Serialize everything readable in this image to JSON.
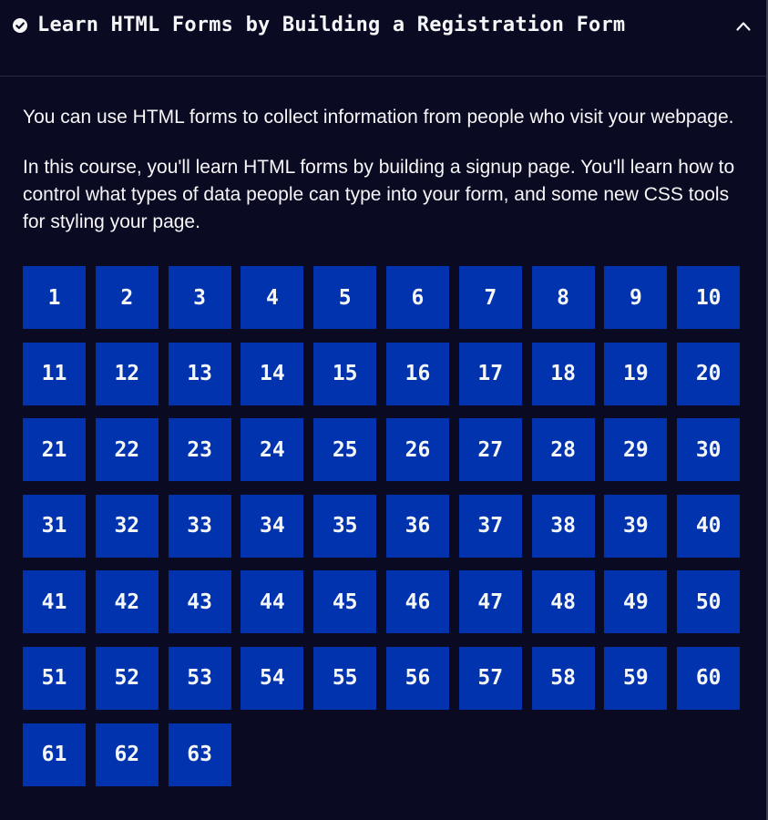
{
  "block": {
    "title": "Learn HTML Forms by Building a Registration Form",
    "icons": {
      "completed": "check-circle-icon",
      "toggle": "chevron-up-icon"
    },
    "description": [
      "You can use HTML forms to collect information from people who visit your webpage.",
      "In this course, you'll learn HTML forms by building a signup page. You'll learn how to control what types of data people can type into your form, and some new CSS tools for styling your page."
    ],
    "steps": [
      "1",
      "2",
      "3",
      "4",
      "5",
      "6",
      "7",
      "8",
      "9",
      "10",
      "11",
      "12",
      "13",
      "14",
      "15",
      "16",
      "17",
      "18",
      "19",
      "20",
      "21",
      "22",
      "23",
      "24",
      "25",
      "26",
      "27",
      "28",
      "29",
      "30",
      "31",
      "32",
      "33",
      "34",
      "35",
      "36",
      "37",
      "38",
      "39",
      "40",
      "41",
      "42",
      "43",
      "44",
      "45",
      "46",
      "47",
      "48",
      "49",
      "50",
      "51",
      "52",
      "53",
      "54",
      "55",
      "56",
      "57",
      "58",
      "59",
      "60",
      "61",
      "62",
      "63"
    ]
  },
  "colors": {
    "background": "#0a0a23",
    "text": "#f5f6f7",
    "step_tile": "#0033ad",
    "border": "#3b3b4f"
  }
}
